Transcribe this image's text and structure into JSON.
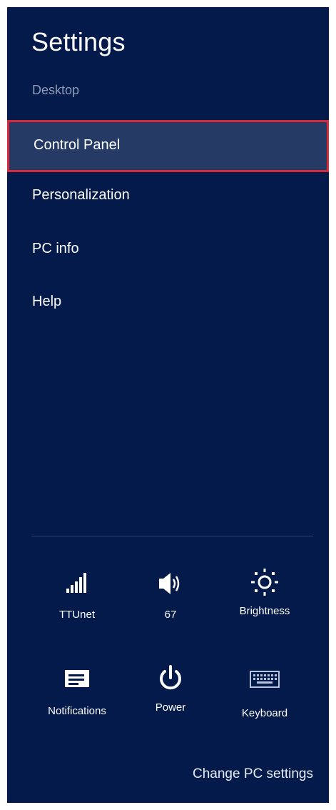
{
  "panel": {
    "title": "Settings",
    "subtitle": "Desktop",
    "background": "#031a4b",
    "highlight_border": "#d42a3c"
  },
  "menu": {
    "items": [
      {
        "label": "Control Panel",
        "selected": true
      },
      {
        "label": "Personalization",
        "selected": false
      },
      {
        "label": "PC info",
        "selected": false
      },
      {
        "label": "Help",
        "selected": false
      }
    ]
  },
  "quick_settings": {
    "network": {
      "label": "TTUnet",
      "icon": "signal-bars-icon"
    },
    "volume": {
      "label": "67",
      "icon": "speaker-icon"
    },
    "brightness": {
      "label": "Brightness",
      "icon": "sun-icon"
    },
    "notifications": {
      "label": "Notifications",
      "icon": "notifications-icon"
    },
    "power": {
      "label": "Power",
      "icon": "power-icon"
    },
    "keyboard": {
      "label": "Keyboard",
      "icon": "keyboard-icon"
    }
  },
  "footer": {
    "change_pc_settings": "Change PC settings"
  }
}
